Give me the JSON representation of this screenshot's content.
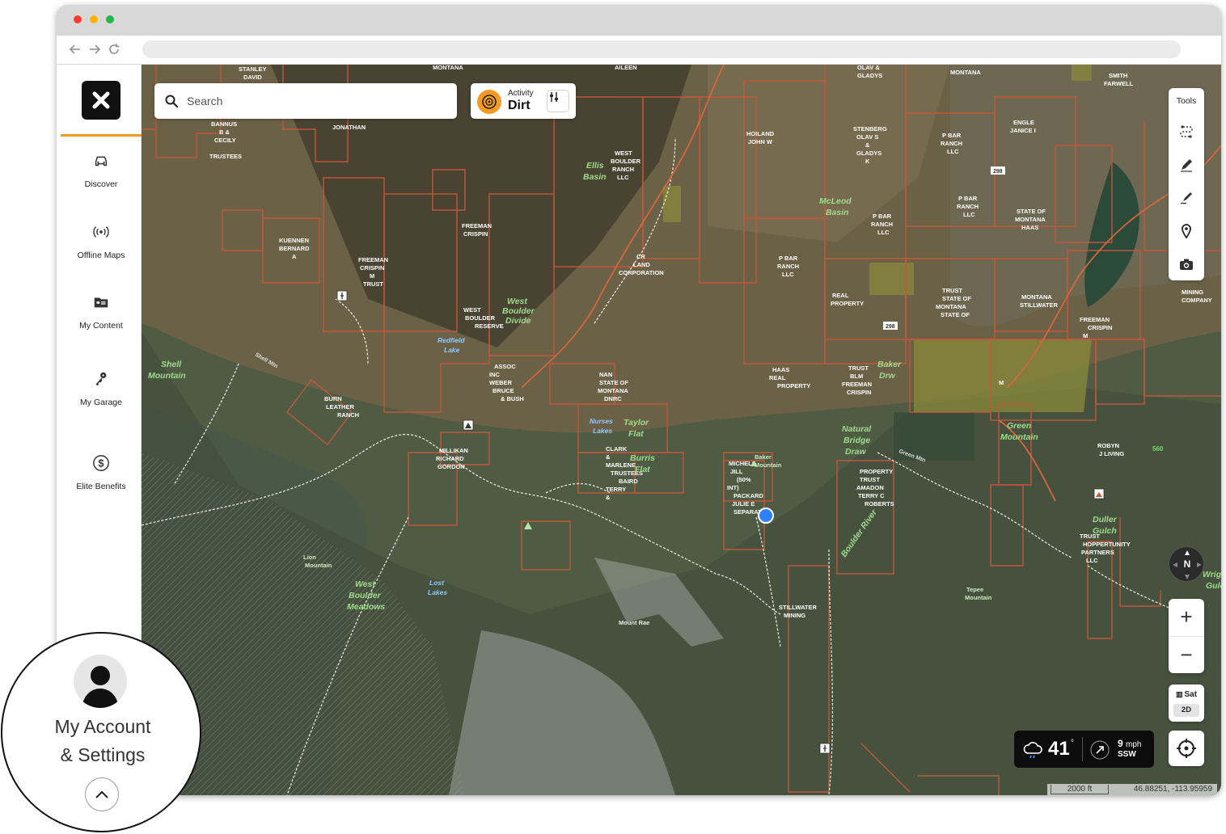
{
  "sidebar": {
    "items": [
      {
        "label": "Discover",
        "icon": "offroad-car-icon"
      },
      {
        "label": "Offline Maps",
        "icon": "broadcast-icon"
      },
      {
        "label": "My Content",
        "icon": "folder-icon"
      },
      {
        "label": "My Garage",
        "icon": "keys-icon"
      },
      {
        "label": "Elite Benefits",
        "icon": "dollar-icon"
      }
    ],
    "account_label_line1": "My Account",
    "account_label_line2": "& Settings"
  },
  "search": {
    "placeholder": "Search"
  },
  "activity": {
    "label": "Activity",
    "value": "Dirt"
  },
  "tools": {
    "title": "Tools"
  },
  "compass": {
    "label": "N"
  },
  "zoom": {
    "in_label": "+",
    "out_label": "−"
  },
  "layers": {
    "basemap": "Sat",
    "mode": "2D"
  },
  "weather": {
    "temperature": "41",
    "degree": "°",
    "wind_speed": "9",
    "wind_unit": "mph",
    "wind_direction": "SSW"
  },
  "scale": {
    "distance": "2000 ft",
    "coordinates": "46.88251, -113.95959"
  },
  "map_labels": {
    "owners": [
      "STANLEY",
      "DAVID",
      "MONTANA",
      "AILEEN",
      "OLAV &",
      "GLADYS",
      "MONTANA",
      "SMITH",
      "FARWELL",
      "BANNUS",
      "B &",
      "CECILY",
      "TRUSTEES",
      "JONATHAN",
      "HOILAND",
      "JOHN W",
      "STENBERG",
      "OLAV S",
      "&",
      "GLADYS",
      "K",
      "P BAR",
      "RANCH",
      "LLC",
      "ENGLE",
      "JANICE I",
      "WEST",
      "BOULDER",
      "RANCH",
      "LLC",
      "KUENNEN",
      "BERNARD",
      "A",
      "FREEMAN",
      "CRISPIN",
      "FREEMAN",
      "CRISPIN",
      "M",
      "TRUST",
      "CR",
      "LAND",
      "CORPORATION",
      "P BAR",
      "RANCH",
      "LLC",
      "P BAR",
      "RANCH",
      "LLC",
      "P BAR",
      "RANCH",
      "LLC",
      "STATE OF",
      "MONTANA",
      "HAAS",
      "REAL",
      "PROPERTY",
      "TRUST",
      "STATE OF",
      "MONTANA",
      "STATE OF",
      "MONTANA",
      "STILLWATER",
      "MINING",
      "COMPANY",
      "FREEMAN",
      "CRISPIN",
      "M",
      "WEST",
      "BOULDER",
      "RESERVE",
      "ASSOC",
      "INC",
      "WEBER",
      "BRUCE",
      "& BUSH",
      "NAN",
      "STATE OF",
      "MONTANA",
      "DNRC",
      "HAAS",
      "REAL",
      "PROPERTY",
      "TRUST",
      "BLM",
      "FREEMAN",
      "CRISPIN",
      "M",
      "BURN",
      "LEATHER",
      "RANCH",
      "MILLIKAN",
      "RICHARD",
      "GORDON",
      "CLARK",
      "&",
      "MARLENE",
      "TRUSTEES",
      "BAIRD",
      "TERRY",
      "&",
      "MICHELS",
      "JILL",
      "(50%",
      "INT)",
      "PACKARD",
      "JULIE E",
      "SEPARATE",
      "PROPERTY",
      "TRUST",
      "AMADON",
      "TERRY C",
      "ROBERTS",
      "ROBYN",
      "J LIVING",
      "TRUST",
      "HOPPERTUNITY",
      "PARTNERS",
      "LLC",
      "STILLWATER",
      "MINING"
    ],
    "places": [
      "Ellis",
      "Basin",
      "McLeod",
      "Basin",
      "West",
      "Boulder",
      "Divide",
      "Shell",
      "Mountain",
      "Baker",
      "Drw",
      "Taylor",
      "Flat",
      "Burris",
      "Flat",
      "Green",
      "Mountain",
      "Natural",
      "Bridge",
      "Draw",
      "Lion",
      "Mountain",
      "West",
      "Boulder",
      "Meadows",
      "Mount Rae",
      "Tepee",
      "Mountain",
      "Baker",
      "Mountain",
      "Duller",
      "Gulch",
      "Boulder River",
      "Wright",
      "Gulch"
    ],
    "water": [
      "Redfield",
      "Lake",
      "Nurses",
      "Lakes",
      "Lost",
      "Lakes"
    ],
    "roads": [
      "298",
      "298",
      "Shell Mtn",
      "Green Mtn",
      "560"
    ]
  }
}
